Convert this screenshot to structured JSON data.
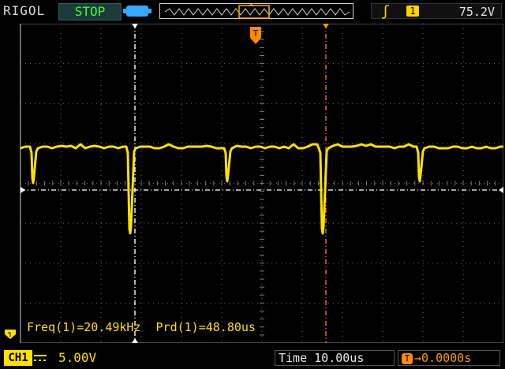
{
  "header": {
    "brand": "RIGOL",
    "run_state": "STOP",
    "trigger": {
      "edge_icon": "rising-edge-icon",
      "source": "1",
      "level": "75.2V"
    }
  },
  "screen": {
    "trigger_marker_label": "T",
    "measurements": [
      {
        "label": "Freq(1)=20.49kHz"
      },
      {
        "label": "Prd(1)=48.80us"
      }
    ]
  },
  "footer": {
    "channel_label": "CH1",
    "coupling_icon": "dc-coupling-icon",
    "volts_per_div": "5.00V",
    "time_label": "Time",
    "time_per_div": "10.00us",
    "delay_icon_letter": "T",
    "delay_value": "0.0000s"
  },
  "colors": {
    "channel1": "#ffe000",
    "grid": "#8a8a8a",
    "cursor_white": "#ffffff",
    "cursor_orange": "#ff9a00",
    "stop_text": "#3dff3d"
  }
}
